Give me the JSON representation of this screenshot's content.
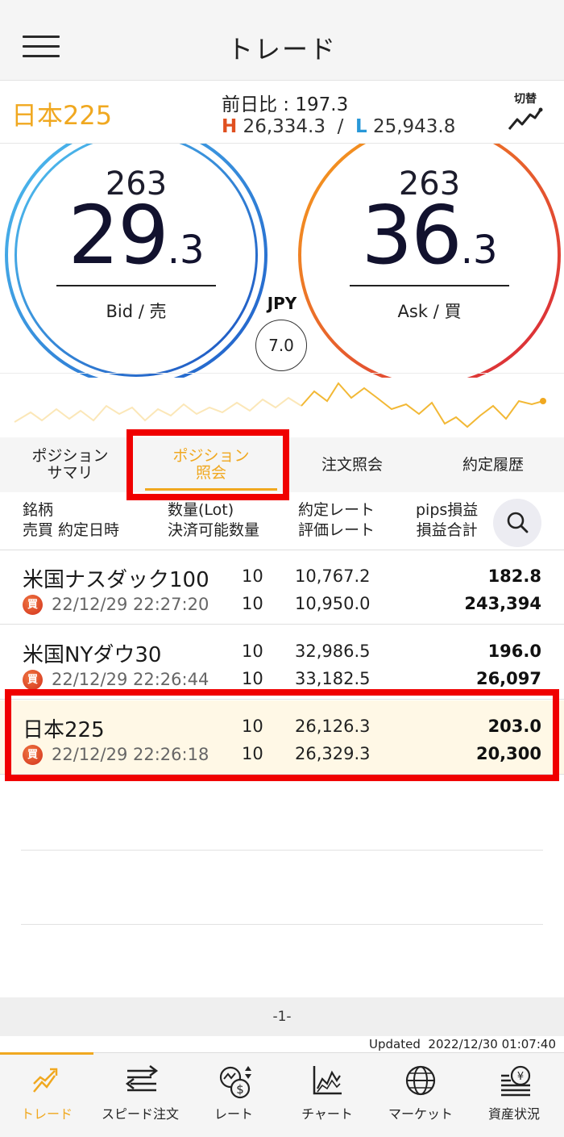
{
  "header": {
    "title": "トレード"
  },
  "symbol": {
    "name": "日本225",
    "prev_label": "前日比 : ",
    "prev_value": "197.3",
    "high_label": "H",
    "high_value": " 26,334.3",
    "sep": "  /  ",
    "low_label": "L",
    "low_value": " 25,943.8",
    "switch_label": "切替"
  },
  "quote": {
    "bid": {
      "top": "263",
      "main": "29",
      "sub": ".3",
      "label": "Bid / 売"
    },
    "ask": {
      "top": "263",
      "main": "36",
      "sub": ".3",
      "label": "Ask / 買"
    },
    "currency": "JPY",
    "spread": "7.0"
  },
  "tabs": [
    {
      "label": "ポジション\nサマリ"
    },
    {
      "label": "ポジション\n照会"
    },
    {
      "label": "注文照会"
    },
    {
      "label": "約定履歴"
    }
  ],
  "columns": {
    "c1a": "銘柄",
    "c1b": "売買 約定日時",
    "c2a": "数量(Lot)",
    "c2b": "決済可能数量",
    "c3a": "約定レート",
    "c3b": "評価レート",
    "c4a": "pips損益",
    "c4b": "損益合計"
  },
  "rows": [
    {
      "name": "米国ナスダック100",
      "side": "買",
      "date": "22/12/29 22:27:20",
      "qty": "10",
      "qty2": "10",
      "rate": "10,767.2",
      "rate2": "10,950.0",
      "pips": "182.8",
      "pl": "243,394"
    },
    {
      "name": "米国NYダウ30",
      "side": "買",
      "date": "22/12/29 22:26:44",
      "qty": "10",
      "qty2": "10",
      "rate": "32,986.5",
      "rate2": "33,182.5",
      "pips": "196.0",
      "pl": "26,097"
    },
    {
      "name": "日本225",
      "side": "買",
      "date": "22/12/29 22:26:18",
      "qty": "10",
      "qty2": "10",
      "rate": "26,126.3",
      "rate2": "26,329.3",
      "pips": "203.0",
      "pl": "20,300"
    }
  ],
  "pager": "-1-",
  "updated": "Updated  2022/12/30 01:07:40",
  "nav": [
    {
      "label": "トレード",
      "icon": "trade-icon"
    },
    {
      "label": "スピード注文",
      "icon": "speed-order-icon"
    },
    {
      "label": "レート",
      "icon": "rate-icon"
    },
    {
      "label": "チャート",
      "icon": "chart-icon"
    },
    {
      "label": "マーケット",
      "icon": "market-icon"
    },
    {
      "label": "資産状況",
      "icon": "assets-icon"
    }
  ],
  "colors": {
    "accent": "#f0a820",
    "highlight_box": "#f00000",
    "buy_badge": "#d3301c",
    "bid_ring": "#1e5ac8",
    "ask_ring": "#d8203c"
  }
}
